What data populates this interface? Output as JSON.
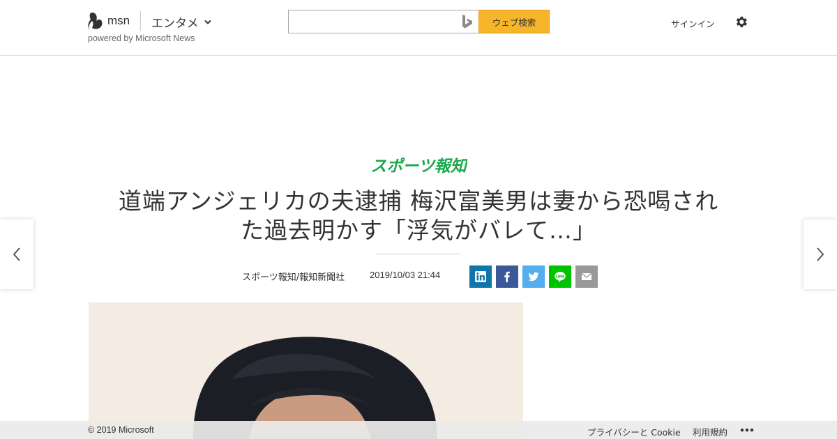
{
  "header": {
    "logo_text": "msn",
    "section": "エンタメ",
    "powered_by": "powered by Microsoft News",
    "search": {
      "value": "",
      "placeholder": "",
      "button_label": "ウェブ検索"
    },
    "signin_label": "サインイン",
    "icons": {
      "logo": "msn-butterfly-icon",
      "bing": "bing-icon",
      "settings": "gear-icon",
      "section_dropdown": "chevron-down-icon"
    }
  },
  "article": {
    "source_logo_text": "スポーツ報知",
    "title_line1": "道端アンジェリカの夫逮捕 梅沢富美男は妻から恐喝され",
    "title_line2": "た過去明かす「浮気がバレて…」",
    "byline": "スポーツ報知/報知新聞社",
    "datetime": "2019/10/03 21:44",
    "share": [
      {
        "name": "linkedin",
        "icon": "linkedin-icon",
        "color": "#0e76a8"
      },
      {
        "name": "facebook",
        "icon": "facebook-icon",
        "color": "#3b5998"
      },
      {
        "name": "twitter",
        "icon": "twitter-icon",
        "color": "#55acee"
      },
      {
        "name": "line",
        "icon": "line-icon",
        "color": "#00c300"
      },
      {
        "name": "email",
        "icon": "mail-icon",
        "color": "#999999"
      }
    ],
    "prev_icon": "chevron-left-icon",
    "next_icon": "chevron-right-icon"
  },
  "colors": {
    "brand_green": "#1aa84b",
    "search_button": "#f7b52b"
  },
  "footer": {
    "copyright": "© 2019 Microsoft",
    "privacy": "プライバシーと Cookie",
    "terms": "利用規約",
    "more": "•••"
  }
}
